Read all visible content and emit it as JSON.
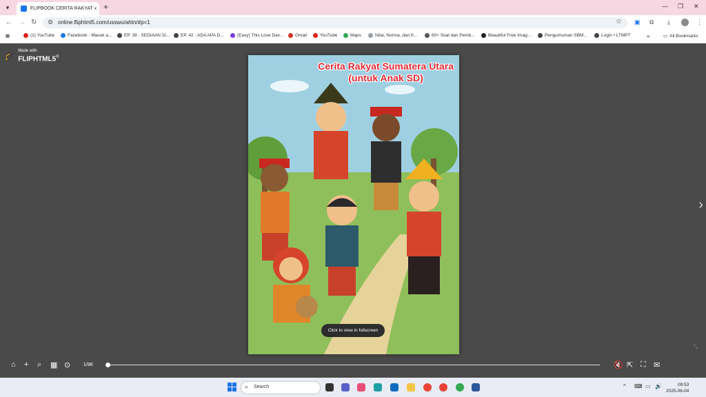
{
  "browser": {
    "tab_title": "FLIPBOOK CERITA RAKYAT SUM",
    "tab_close": "×",
    "new_tab": "+",
    "url": "online.fliphtml5.com/usswu/ahtn/#p=1",
    "bookmarks": [
      {
        "label": "(1) YouTube",
        "color": "#e62117"
      },
      {
        "label": "Facebook - Masuk a...",
        "color": "#1877f2"
      },
      {
        "label": "EP. 39 - SEDIAAN SI...",
        "color": "#444444"
      },
      {
        "label": "EP. 42 - ADA APA D...",
        "color": "#444444"
      },
      {
        "label": "(Easy) This Love Dav...",
        "color": "#7b3fe4"
      },
      {
        "label": "Gmail",
        "color": "#d93025"
      },
      {
        "label": "YouTube",
        "color": "#e62117"
      },
      {
        "label": "Maps",
        "color": "#34a853"
      },
      {
        "label": "Nilai, Norma, dan K...",
        "color": "#9aa0a6"
      },
      {
        "label": "60+ Soal dan Pemb...",
        "color": "#555555"
      },
      {
        "label": "Beautiful Free Imag...",
        "color": "#222222"
      },
      {
        "label": "Pengumuman SBM...",
        "color": "#444444"
      },
      {
        "label": "Login • LTMPT",
        "color": "#444444"
      }
    ],
    "bookmarks_more": "»",
    "all_bookmarks": "All Bookmarks"
  },
  "viewer": {
    "logo_made": "Made with",
    "logo_brand": "FLIPHTML5",
    "logo_reg": "®",
    "book_title_line1": "Cerita Rakyat Sumatera Utara",
    "book_title_line2": "(untuk Anak SD)",
    "fullscreen_hint": "Click to view in fullscreen",
    "page_number": "1/96",
    "progress": 0.0
  },
  "taskbar": {
    "search_label": "Search",
    "time": "09:53",
    "date": "2025-06-04"
  }
}
